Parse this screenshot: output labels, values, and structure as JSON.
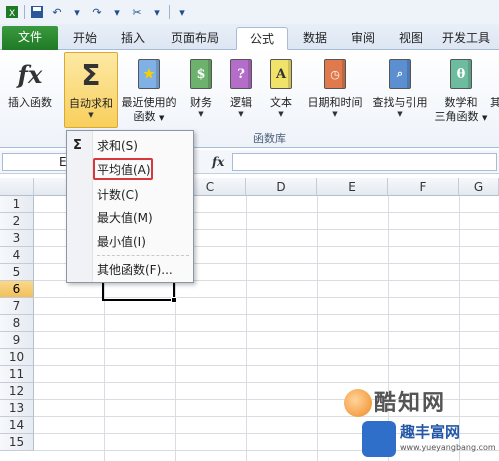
{
  "ribbon_tabs": [
    "文件",
    "开始",
    "插入",
    "页面布局",
    "公式",
    "数据",
    "审阅",
    "视图",
    "开发工具"
  ],
  "ribbon_buttons": {
    "insert_function": "插入函数",
    "autosum": "自动求和",
    "recent_1": "最近使用的",
    "recent_2": "函数",
    "financial": "财务",
    "logical": "逻辑",
    "text": "文本",
    "datetime": "日期和时间",
    "lookup": "查找与引用",
    "math_1": "数学和",
    "math_2": "三角函数",
    "more": "其"
  },
  "ribbon_group_label": "函数库",
  "formula_bar": {
    "fx": "fx",
    "namebox_char": "E"
  },
  "columns": [
    "C",
    "D",
    "E",
    "F",
    "G"
  ],
  "rows": [
    "1",
    "2",
    "3",
    "4",
    "5",
    "6",
    "7",
    "8",
    "9",
    "10",
    "11",
    "12",
    "13",
    "14",
    "15"
  ],
  "dropdown": {
    "sigma": "Σ",
    "items": [
      "求和(S)",
      "平均值(A)",
      "计数(C)",
      "最大值(M)",
      "最小值(I)",
      "其他函数(F)..."
    ]
  },
  "watermark": {
    "brand": "酷知网",
    "sub": "趣丰富网",
    "url": "www.yueyangbang.com"
  },
  "colors": {
    "file_tab": "#1f7a26",
    "highlight": "#f8cf5c",
    "red_box": "#d9383a",
    "selected_row": "#f1c05a"
  }
}
